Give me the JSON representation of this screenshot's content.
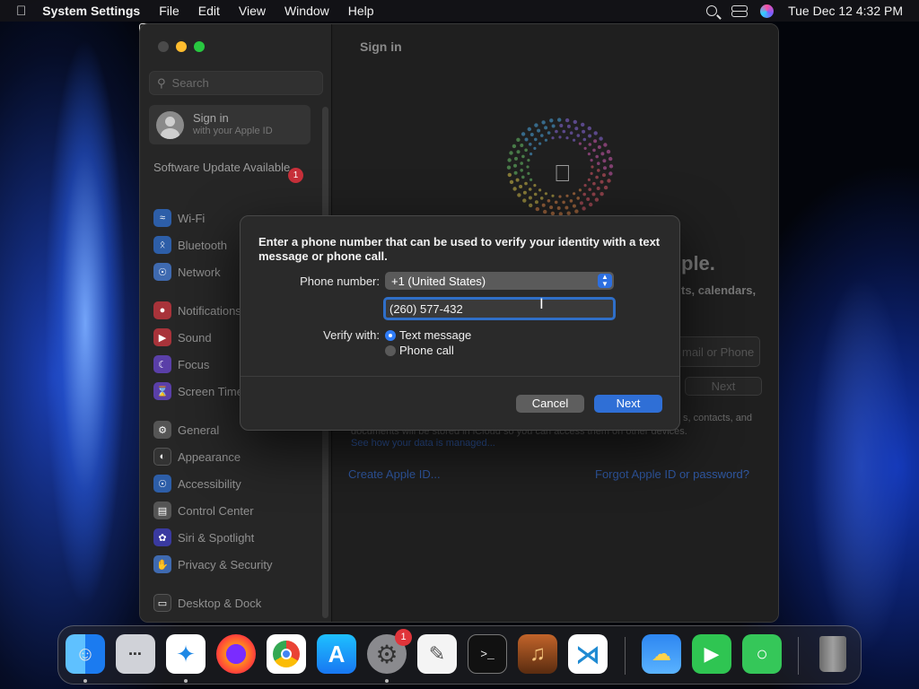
{
  "menubar": {
    "apple_icon": "apple-icon",
    "app_name": "System Settings",
    "menus": [
      "File",
      "Edit",
      "View",
      "Window",
      "Help"
    ],
    "clock": "Tue Dec 12  4:32 PM"
  },
  "sidebar": {
    "search_placeholder": "Search",
    "signin_title": "Sign in",
    "signin_subtitle": "with your Apple ID",
    "update_label": "Software Update Available",
    "update_count": "1",
    "items": [
      {
        "label": "Wi-Fi",
        "icon": "wifi-icon"
      },
      {
        "label": "Bluetooth",
        "icon": "bluetooth-icon"
      },
      {
        "label": "Network",
        "icon": "globe-icon"
      },
      {
        "label": "Notifications",
        "icon": "bell-icon"
      },
      {
        "label": "Sound",
        "icon": "speaker-icon"
      },
      {
        "label": "Focus",
        "icon": "moon-icon"
      },
      {
        "label": "Screen Time",
        "icon": "hourglass-icon"
      },
      {
        "label": "General",
        "icon": "gear-icon"
      },
      {
        "label": "Appearance",
        "icon": "appearance-icon"
      },
      {
        "label": "Accessibility",
        "icon": "accessibility-icon"
      },
      {
        "label": "Control Center",
        "icon": "control-center-icon"
      },
      {
        "label": "Siri & Spotlight",
        "icon": "siri-icon"
      },
      {
        "label": "Privacy & Security",
        "icon": "hand-icon"
      },
      {
        "label": "Desktop & Dock",
        "icon": "dock-icon"
      }
    ]
  },
  "content": {
    "title": "Sign in",
    "headline_fragment": "ple.",
    "subtitle_fragment": "ts, calendars,",
    "field_placeholder_fragment": "mail or Phone",
    "next_fragment": "Next",
    "body_fragment_1": "s, contacts, and",
    "body_fragment_2": "documents will be stored in iCloud so you can access them on other devices.",
    "body_link_fragment": "See how your data is managed...",
    "create_link": "Create Apple ID...",
    "forgot_link": "Forgot Apple ID or password?"
  },
  "dialog": {
    "message": "Enter a phone number that can be used to verify your identity with a text message or phone call.",
    "phone_label": "Phone number:",
    "country_value": "+1 (United States)",
    "phone_value": "(260) 577-432",
    "verify_label": "Verify with:",
    "options": [
      {
        "label": "Text message",
        "selected": true
      },
      {
        "label": "Phone call",
        "selected": false
      }
    ],
    "cancel_label": "Cancel",
    "next_label": "Next"
  },
  "dock": {
    "apps": [
      {
        "name": "Finder",
        "icon": "finder-icon",
        "running": true
      },
      {
        "name": "Launchpad",
        "icon": "launchpad-icon",
        "running": false
      },
      {
        "name": "Safari",
        "icon": "safari-icon",
        "running": true
      },
      {
        "name": "Firefox",
        "icon": "firefox-icon",
        "running": false
      },
      {
        "name": "Chrome",
        "icon": "chrome-icon",
        "running": false
      },
      {
        "name": "App Store",
        "icon": "app-store-icon",
        "running": false
      },
      {
        "name": "System Settings",
        "icon": "system-settings-icon",
        "running": true,
        "badge": "1"
      },
      {
        "name": "TextEdit",
        "icon": "textedit-icon",
        "running": false
      },
      {
        "name": "Terminal",
        "icon": "terminal-icon",
        "running": false
      },
      {
        "name": "GarageBand",
        "icon": "garageband-icon",
        "running": false
      },
      {
        "name": "VS Code",
        "icon": "vscode-icon",
        "running": false
      },
      {
        "name": "Weather",
        "icon": "weather-icon",
        "running": false
      },
      {
        "name": "FaceTime",
        "icon": "facetime-icon",
        "running": false
      },
      {
        "name": "Messages",
        "icon": "messages-icon",
        "running": false
      },
      {
        "name": "Trash",
        "icon": "trash-icon",
        "running": false
      }
    ],
    "terminal_glyph": ">_",
    "vscode_glyph": "⋊"
  },
  "colors": {
    "accent": "#2f6fd6",
    "badge": "#e0343a",
    "dialog_bg": "#2a2a2a"
  }
}
